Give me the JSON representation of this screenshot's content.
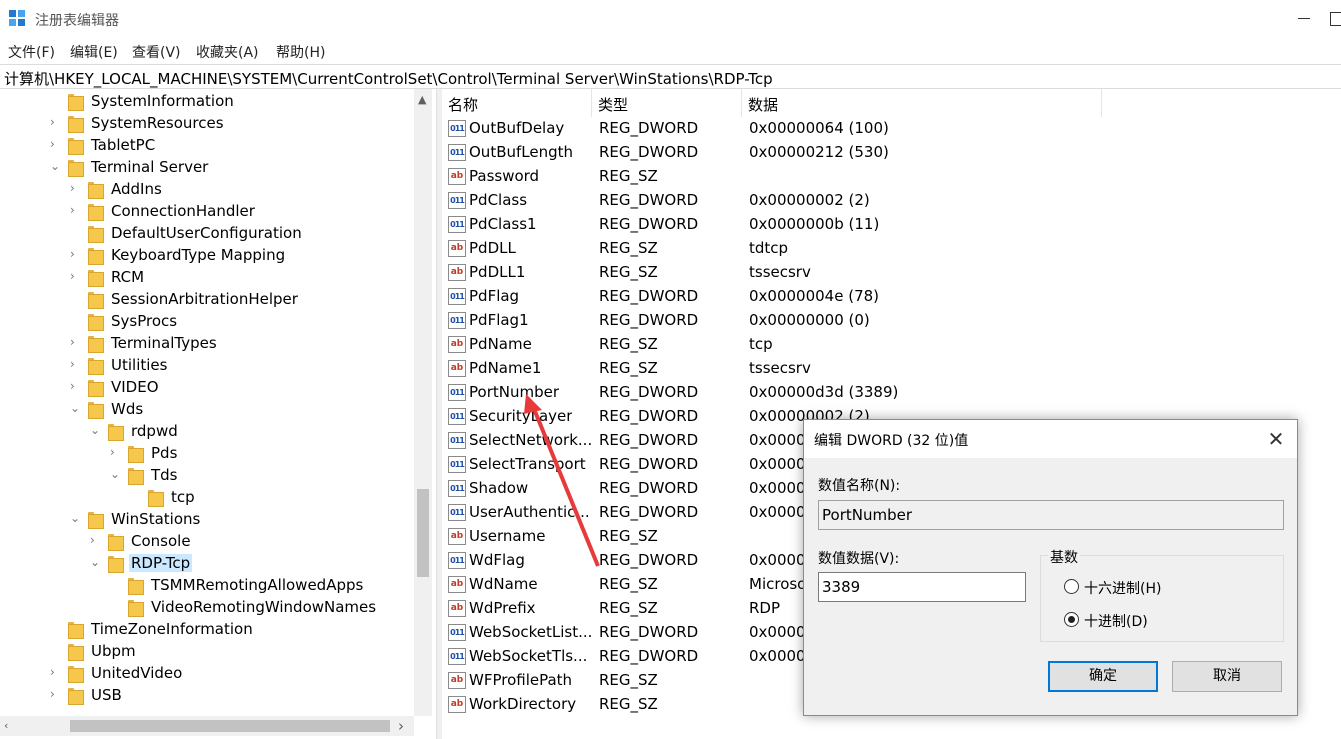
{
  "window": {
    "title": "注册表编辑器"
  },
  "menu": [
    "文件(F)",
    "编辑(E)",
    "查看(V)",
    "收藏夹(A)",
    "帮助(H)"
  ],
  "address": "计算机\\HKEY_LOCAL_MACHINE\\SYSTEM\\CurrentControlSet\\Control\\Terminal Server\\WinStations\\RDP-Tcp",
  "tree": [
    {
      "label": "SystemInformation",
      "chevron": ""
    },
    {
      "label": "SystemResources",
      "chevron": "›"
    },
    {
      "label": "TabletPC",
      "chevron": "›"
    },
    {
      "label": "Terminal Server",
      "chevron": "⌄"
    },
    {
      "label": "AddIns",
      "chevron": "›"
    },
    {
      "label": "ConnectionHandler",
      "chevron": "›"
    },
    {
      "label": "DefaultUserConfiguration",
      "chevron": ""
    },
    {
      "label": "KeyboardType Mapping",
      "chevron": "›"
    },
    {
      "label": "RCM",
      "chevron": "›"
    },
    {
      "label": "SessionArbitrationHelper",
      "chevron": ""
    },
    {
      "label": "SysProcs",
      "chevron": ""
    },
    {
      "label": "TerminalTypes",
      "chevron": "›"
    },
    {
      "label": "Utilities",
      "chevron": "›"
    },
    {
      "label": "VIDEO",
      "chevron": "›"
    },
    {
      "label": "Wds",
      "chevron": "⌄"
    },
    {
      "label": "rdpwd",
      "chevron": "⌄"
    },
    {
      "label": "Pds",
      "chevron": "›"
    },
    {
      "label": "Tds",
      "chevron": "⌄"
    },
    {
      "label": "tcp",
      "chevron": ""
    },
    {
      "label": "WinStations",
      "chevron": "⌄"
    },
    {
      "label": "Console",
      "chevron": "›"
    },
    {
      "label": "RDP-Tcp",
      "chevron": "⌄"
    },
    {
      "label": "TSMMRemotingAllowedApps",
      "chevron": ""
    },
    {
      "label": "VideoRemotingWindowNames",
      "chevron": ""
    },
    {
      "label": "TimeZoneInformation",
      "chevron": ""
    },
    {
      "label": "Ubpm",
      "chevron": ""
    },
    {
      "label": "UnitedVideo",
      "chevron": "›"
    },
    {
      "label": "USB",
      "chevron": "›"
    }
  ],
  "columns": [
    "名称",
    "类型",
    "数据"
  ],
  "values": [
    {
      "name": "OutBufDelay",
      "type": "REG_DWORD",
      "data": "0x00000064 (100)",
      "icon": "bin"
    },
    {
      "name": "OutBufLength",
      "type": "REG_DWORD",
      "data": "0x00000212 (530)",
      "icon": "bin"
    },
    {
      "name": "Password",
      "type": "REG_SZ",
      "data": "",
      "icon": "sz"
    },
    {
      "name": "PdClass",
      "type": "REG_DWORD",
      "data": "0x00000002 (2)",
      "icon": "bin"
    },
    {
      "name": "PdClass1",
      "type": "REG_DWORD",
      "data": "0x0000000b (11)",
      "icon": "bin"
    },
    {
      "name": "PdDLL",
      "type": "REG_SZ",
      "data": "tdtcp",
      "icon": "sz"
    },
    {
      "name": "PdDLL1",
      "type": "REG_SZ",
      "data": "tssecsrv",
      "icon": "sz"
    },
    {
      "name": "PdFlag",
      "type": "REG_DWORD",
      "data": "0x0000004e (78)",
      "icon": "bin"
    },
    {
      "name": "PdFlag1",
      "type": "REG_DWORD",
      "data": "0x00000000 (0)",
      "icon": "bin"
    },
    {
      "name": "PdName",
      "type": "REG_SZ",
      "data": "tcp",
      "icon": "sz"
    },
    {
      "name": "PdName1",
      "type": "REG_SZ",
      "data": "tssecsrv",
      "icon": "sz"
    },
    {
      "name": "PortNumber",
      "type": "REG_DWORD",
      "data": "0x00000d3d (3389)",
      "icon": "bin"
    },
    {
      "name": "SecurityLayer",
      "type": "REG_DWORD",
      "data": "0x00000002 (2)",
      "icon": "bin"
    },
    {
      "name": "SelectNetwork...",
      "type": "REG_DWORD",
      "data": "0x00000",
      "icon": "bin"
    },
    {
      "name": "SelectTransport",
      "type": "REG_DWORD",
      "data": "0x00000",
      "icon": "bin"
    },
    {
      "name": "Shadow",
      "type": "REG_DWORD",
      "data": "0x00000",
      "icon": "bin"
    },
    {
      "name": "UserAuthentic...",
      "type": "REG_DWORD",
      "data": "0x00000",
      "icon": "bin"
    },
    {
      "name": "Username",
      "type": "REG_SZ",
      "data": "",
      "icon": "sz"
    },
    {
      "name": "WdFlag",
      "type": "REG_DWORD",
      "data": "0x00000",
      "icon": "bin"
    },
    {
      "name": "WdName",
      "type": "REG_SZ",
      "data": "Microso",
      "icon": "sz"
    },
    {
      "name": "WdPrefix",
      "type": "REG_SZ",
      "data": "RDP",
      "icon": "sz"
    },
    {
      "name": "WebSocketList...",
      "type": "REG_DWORD",
      "data": "0x00000",
      "icon": "bin"
    },
    {
      "name": "WebSocketTls...",
      "type": "REG_DWORD",
      "data": "0x00000",
      "icon": "bin"
    },
    {
      "name": "WFProfilePath",
      "type": "REG_SZ",
      "data": "",
      "icon": "sz"
    },
    {
      "name": "WorkDirectory",
      "type": "REG_SZ",
      "data": "",
      "icon": "sz"
    }
  ],
  "dialog": {
    "title": "编辑 DWORD (32 位)值",
    "name_label": "数值名称(N):",
    "name_value": "PortNumber",
    "data_label": "数值数据(V):",
    "data_value": "3389",
    "base_label": "基数",
    "hex_label": "十六进制(H)",
    "dec_label": "十进制(D)",
    "selected_base": "decimal",
    "ok": "确定",
    "cancel": "取消"
  },
  "colors": {
    "selection": "#cce8ff",
    "annotation_arrow": "#e8393b",
    "primary_border": "#0078d7"
  }
}
